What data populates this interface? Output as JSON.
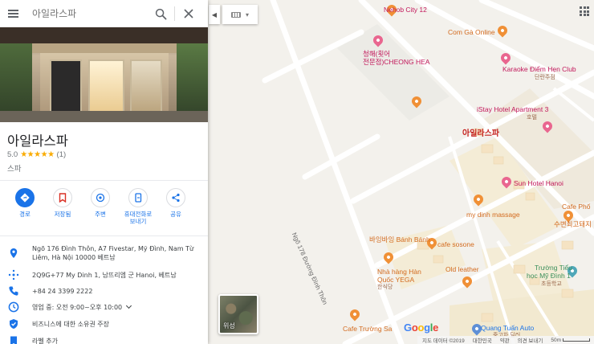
{
  "search": {
    "placeholder": "아일라스파"
  },
  "place": {
    "name": "아일라스파",
    "rating": "5.0",
    "stars": "★★★★★",
    "review_count": "(1)",
    "category": "스파"
  },
  "actions": [
    {
      "label": "경로",
      "icon": "directions-icon"
    },
    {
      "label": "저장됨",
      "icon": "bookmark-icon"
    },
    {
      "label": "주변",
      "icon": "nearby-icon"
    },
    {
      "label_line1": "휴대전화로",
      "label_line2": "보내기",
      "icon": "send-to-phone-icon"
    },
    {
      "label": "공유",
      "icon": "share-icon"
    }
  ],
  "info": {
    "address": "Ngõ 176 Đình Thôn, A7 Fivestar, Mỹ Đình, Nam Từ Liêm, Hà Nội 10000 베트남",
    "plus_code": "2Q9G+77 My Dinh 1, 남뜨리엠 군 Hanoi, 베트남",
    "phone": "+84 24 3399 2222",
    "hours_status": "영업 중:",
    "hours": "오전 9:00~오후 10:00",
    "claim": "비즈니스에 대한 소유권 주장",
    "add_label": "라벨 추가"
  },
  "map": {
    "selected_pin_label": "아일라스파",
    "satellite_label": "위성",
    "labels": {
      "nehob": "Nehob City 12",
      "com_ga": "Com Gà Online",
      "cheonghae_1": "청해(횟어",
      "cheonghae_2": "전문점)CHEONG HEA",
      "karaoke": "Karaoke Điểm Hẹn Club",
      "karaoke_sub": "단란주점",
      "istay": "iStay Hotel Apartment 3",
      "istay_sub": "호텔",
      "sun_hotel": "Sun Hotel Hanoi",
      "cafe_pho": "Cafe Phố",
      "bbq": "수변최고돼지",
      "my_dinh_massage": "my dinh massage",
      "banh_banh": "바잉바잉 Bánh Bánh",
      "cafe_sosone": "cafe sosone",
      "nha_hang_1": "Nhà hàng Hàn",
      "nha_hang_2": "Quốc YEGA",
      "nha_hang_sub": "한식당",
      "old_leather": "Old leather",
      "school_1": "Trường Tiểu",
      "school_2": "học Mỹ Đình 1",
      "school_sub": "초등학교",
      "cafe_truong_sa": "Cafe Trường Sa",
      "quang_tuan": "Quang Tuấn Auto",
      "quang_tuan_sub": "중고차 딜러",
      "street": "Ngõ 178 Đường Đình Thôn"
    },
    "google_logo": "Google",
    "footer": [
      "지도 데이터 ©2019",
      "대한민국",
      "약관",
      "의견 보내기",
      "50m"
    ]
  },
  "colors": {
    "accent_blue": "#1a73e8",
    "pin_red": "#ea4335",
    "star_gold": "#f9ab00"
  }
}
